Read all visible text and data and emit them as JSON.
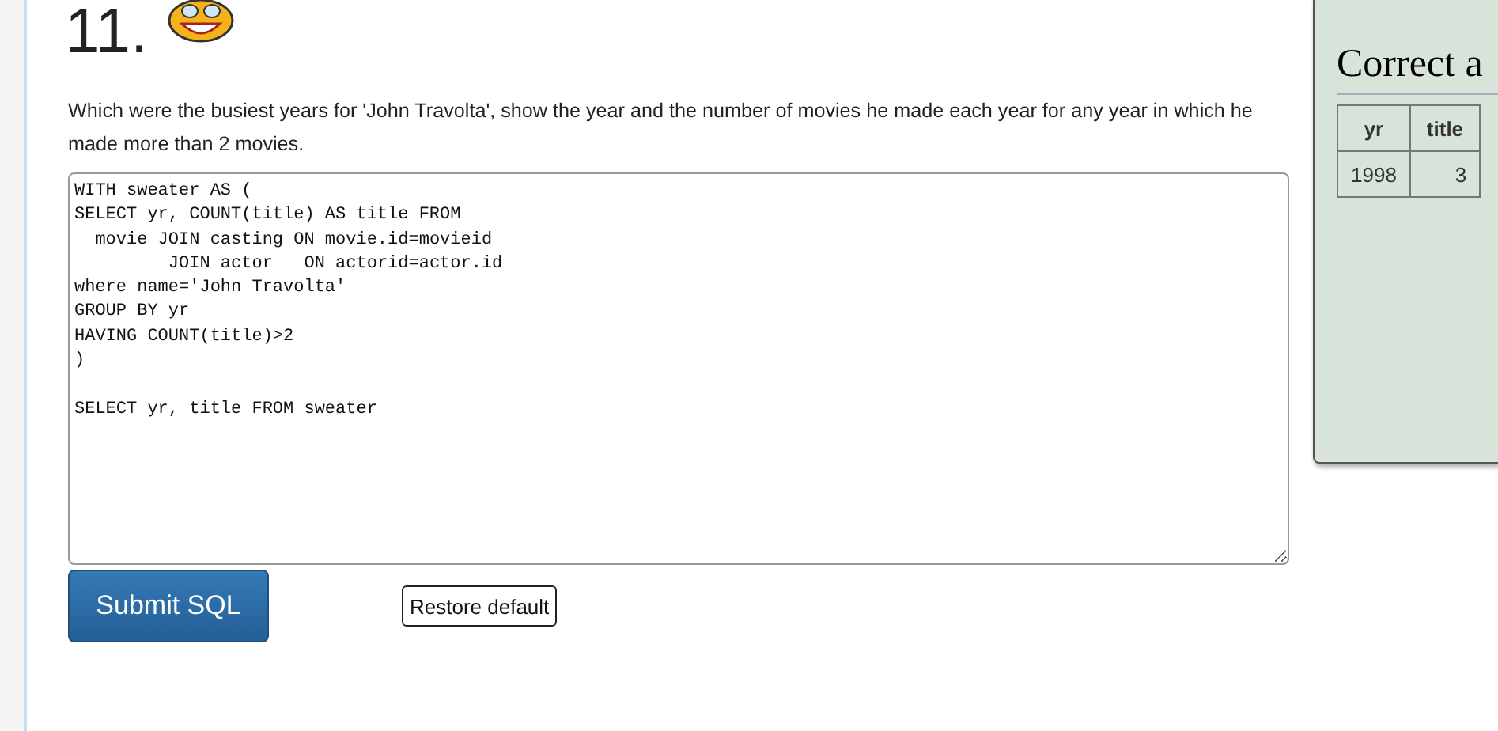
{
  "question": {
    "number": "11.",
    "text": "Which were the busiest years for 'John Travolta', show the year and the number of movies he made each year for any year in which he made more than 2 movies."
  },
  "editor": {
    "value": "WITH sweater AS (\nSELECT yr, COUNT(title) AS title FROM\n  movie JOIN casting ON movie.id=movieid\n         JOIN actor   ON actorid=actor.id\nwhere name='John Travolta'\nGROUP BY yr\nHAVING COUNT(title)>2\n)\n\nSELECT yr, title FROM sweater"
  },
  "buttons": {
    "submit": "Submit SQL",
    "restore": "Restore default"
  },
  "result": {
    "title": "Correct a",
    "columns": [
      "yr",
      "title"
    ],
    "rows": [
      [
        "1998",
        "3"
      ]
    ]
  }
}
